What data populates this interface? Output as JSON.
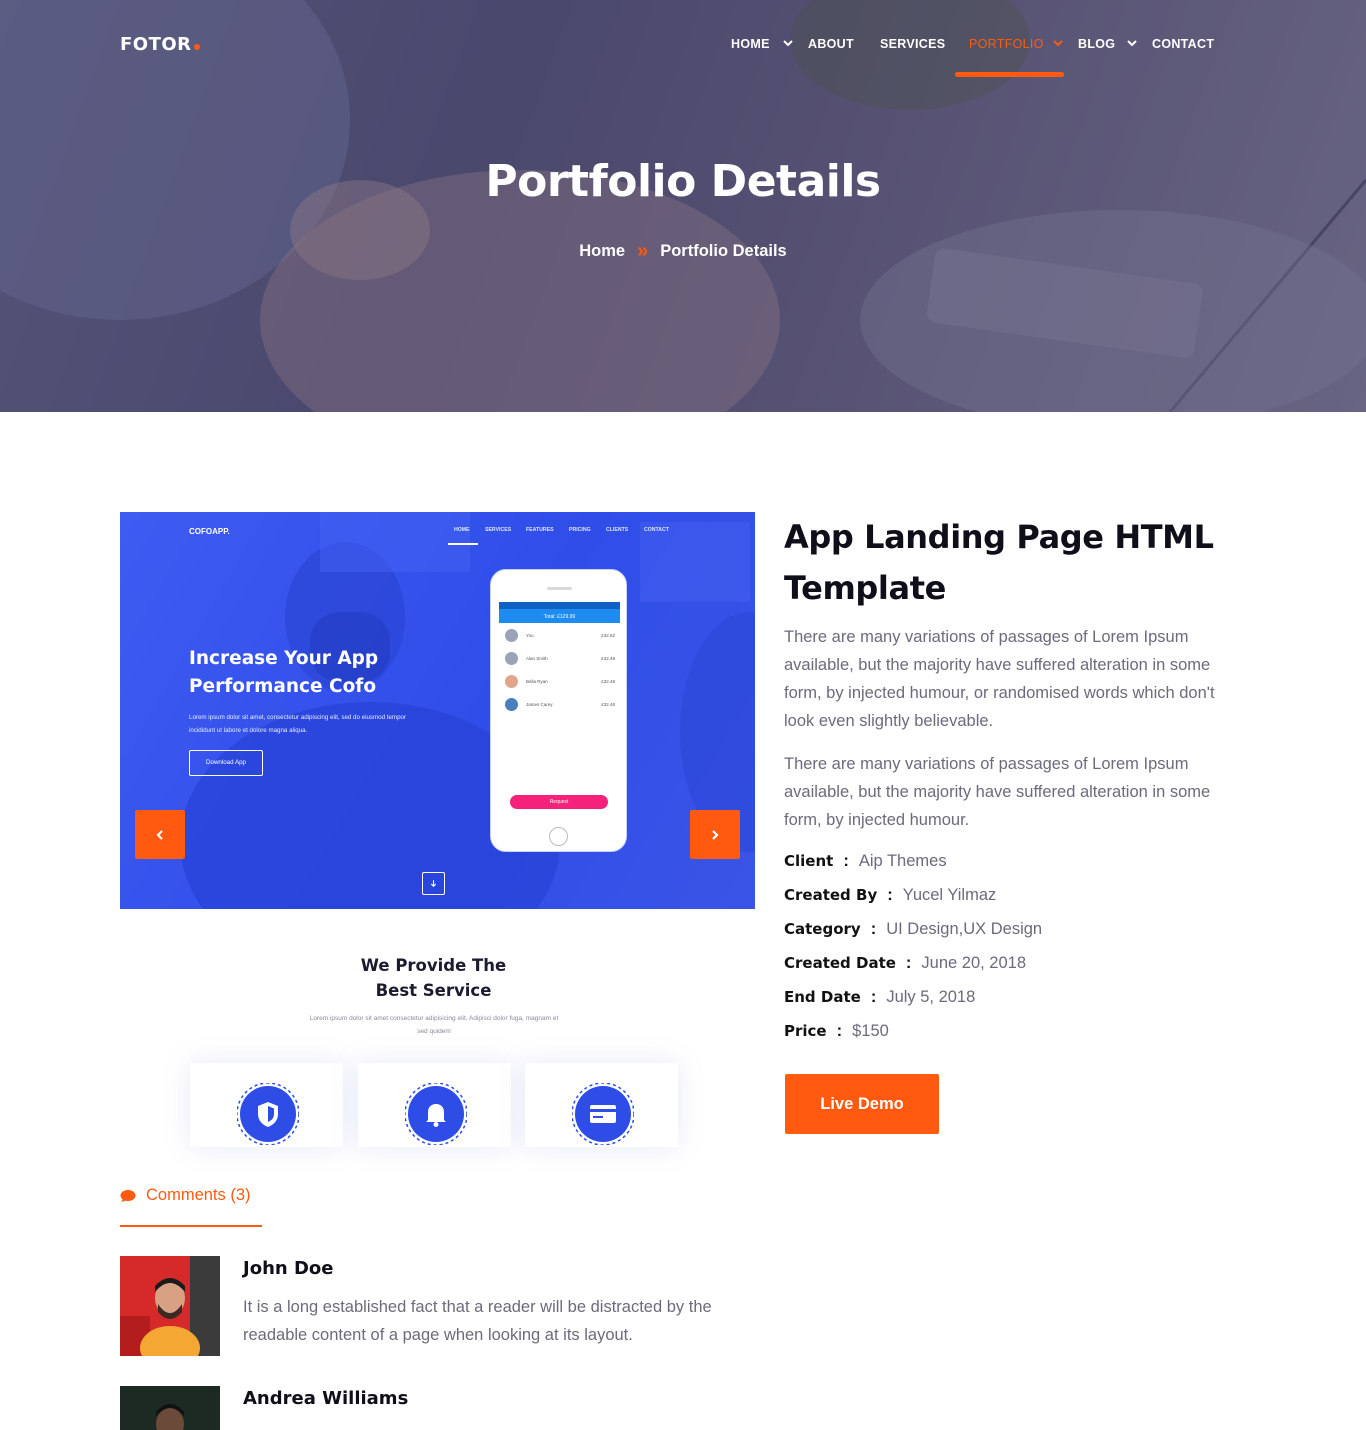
{
  "nav": {
    "logo": "FOTOR",
    "items": [
      {
        "label": "HOME",
        "has_dropdown": true,
        "active": false
      },
      {
        "label": "ABOUT",
        "has_dropdown": false,
        "active": false
      },
      {
        "label": "SERVICES",
        "has_dropdown": false,
        "active": false
      },
      {
        "label": "PORTFOLIO",
        "has_dropdown": true,
        "active": true
      },
      {
        "label": "BLOG",
        "has_dropdown": true,
        "active": false
      },
      {
        "label": "CONTACT",
        "has_dropdown": false,
        "active": false
      }
    ]
  },
  "hero": {
    "title": "Portfolio Details",
    "breadcrumb": {
      "home": "Home",
      "separator": "»",
      "current": "Portfolio Details"
    }
  },
  "preview": {
    "logo": "COFOAPP.",
    "nav": [
      "HOME",
      "SERVICES",
      "FEATURES",
      "PRICING",
      "CLIENTS",
      "CONTACT"
    ],
    "headline": "Increase Your App Performance Cofo",
    "text": "Lorem ipsum dolor sit amet, consectetur adipiscing elit, sed do eiusmod tempor incididunt ut labore et dolore magna aliqua.",
    "button": "Download App",
    "phone": {
      "header": "Total: £129.99",
      "rows": [
        {
          "name": "You",
          "amount": "£32.52"
        },
        {
          "name": "Alan Smith",
          "amount": "£32.48"
        },
        {
          "name": "Bella Ryan",
          "amount": "£32.48"
        },
        {
          "name": "James Carey",
          "amount": "£32.48"
        }
      ],
      "button": "Request"
    },
    "prev_icon": "chevron-left-icon",
    "next_icon": "chevron-right-icon"
  },
  "services": {
    "title": "We Provide The Best Service",
    "text": "Lorem ipsum dolor sit amet consectetur adipisicing elit. Adipisci dolor fuga, magnam et sed quidem",
    "icons": [
      "shield-icon",
      "bell-icon",
      "card-icon"
    ]
  },
  "project": {
    "title": "App Landing Page HTML Template",
    "paragraph_1": "There are many variations of passages of Lorem Ipsum available, but the majority have suffered alteration in some form, by injected humour, or randomised words which don't look even slightly believable.",
    "paragraph_2": "There are many variations of passages of Lorem Ipsum available, but the majority have suffered alteration in some form, by injected humour.",
    "meta": [
      {
        "key": "Client",
        "value": "Aip Themes"
      },
      {
        "key": "Created By",
        "value": "Yucel Yilmaz"
      },
      {
        "key": "Category",
        "value": "UI Design,UX Design"
      },
      {
        "key": "Created Date",
        "value": "June 20, 2018"
      },
      {
        "key": "End Date",
        "value": "July 5, 2018"
      },
      {
        "key": "Price",
        "value": "$150"
      }
    ],
    "meta_separator": ":",
    "button": "Live Demo"
  },
  "comments": {
    "heading": "Comments (3)",
    "icon": "chat-bubble-icon",
    "items": [
      {
        "name": "John Doe",
        "text": "It is a long established fact that a reader will be distracted by the readable content of a page when looking at its layout."
      },
      {
        "name": "Andrea Williams",
        "text": ""
      }
    ]
  },
  "colors": {
    "accent": "#ff5a0f",
    "preview_blue": "#3150ea",
    "heading": "#0f0f1a",
    "body_text": "#6b6b7b"
  }
}
